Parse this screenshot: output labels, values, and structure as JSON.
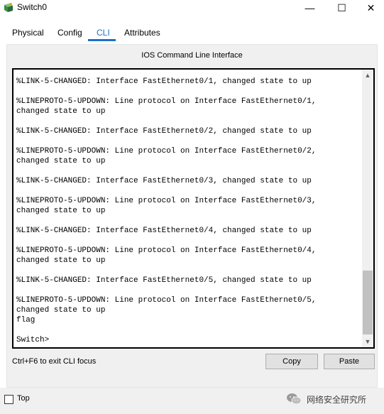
{
  "window": {
    "title": "Switch0",
    "minimize_glyph": "—",
    "maximize_glyph": "☐",
    "close_glyph": "✕"
  },
  "tabs": [
    {
      "label": "Physical"
    },
    {
      "label": "Config"
    },
    {
      "label": "CLI",
      "active": true
    },
    {
      "label": "Attributes"
    }
  ],
  "cli": {
    "heading": "IOS Command Line Interface",
    "lines": [
      "%LINK-5-CHANGED: Interface FastEthernet0/1, changed state to up",
      "",
      "%LINEPROTO-5-UPDOWN: Line protocol on Interface FastEthernet0/1,",
      "changed state to up",
      "",
      "%LINK-5-CHANGED: Interface FastEthernet0/2, changed state to up",
      "",
      "%LINEPROTO-5-UPDOWN: Line protocol on Interface FastEthernet0/2,",
      "changed state to up",
      "",
      "%LINK-5-CHANGED: Interface FastEthernet0/3, changed state to up",
      "",
      "%LINEPROTO-5-UPDOWN: Line protocol on Interface FastEthernet0/3,",
      "changed state to up",
      "",
      "%LINK-5-CHANGED: Interface FastEthernet0/4, changed state to up",
      "",
      "%LINEPROTO-5-UPDOWN: Line protocol on Interface FastEthernet0/4,",
      "changed state to up",
      "",
      "%LINK-5-CHANGED: Interface FastEthernet0/5, changed state to up",
      "",
      "%LINEPROTO-5-UPDOWN: Line protocol on Interface FastEthernet0/5,",
      "changed state to up",
      "flag",
      "",
      "Switch>"
    ],
    "exit_hint": "Ctrl+F6 to exit CLI focus",
    "copy_label": "Copy",
    "paste_label": "Paste",
    "scroll_up_glyph": "▲",
    "scroll_down_glyph": "▼"
  },
  "bottom": {
    "top_label": "Top",
    "top_checked": false,
    "watermark_text": "网络安全研究所"
  },
  "colors": {
    "accent": "#1a73c9",
    "panel": "#f0f0f0",
    "button": "#e1e1e1"
  }
}
